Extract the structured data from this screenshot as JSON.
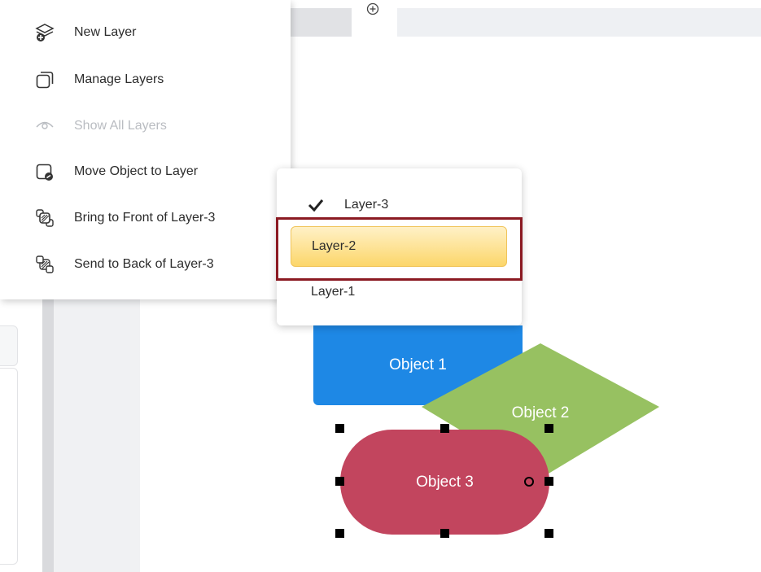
{
  "context_menu": {
    "items": [
      {
        "label": "New Layer",
        "icon": "new-layer-icon",
        "disabled": false
      },
      {
        "label": "Manage Layers",
        "icon": "manage-layers-icon",
        "disabled": false
      },
      {
        "label": "Show All Layers",
        "icon": "eye-icon",
        "disabled": true
      },
      {
        "label": "Move Object to Layer",
        "icon": "move-to-layer-icon",
        "disabled": false
      },
      {
        "label": "Bring to Front of Layer-3",
        "icon": "bring-front-icon",
        "disabled": false
      },
      {
        "label": "Send to Back of Layer-3",
        "icon": "send-back-icon",
        "disabled": false
      }
    ]
  },
  "layer_submenu": {
    "items": [
      {
        "label": "Layer-3",
        "checked": true
      },
      {
        "label": "Layer-2",
        "highlighted": true
      },
      {
        "label": "Layer-1"
      }
    ]
  },
  "diagram": {
    "object1": {
      "label": "Object 1",
      "color": "#1e88e5"
    },
    "object2": {
      "label": "Object 2",
      "color": "#97c161"
    },
    "object3": {
      "label": "Object 3",
      "color": "#c2455e"
    }
  },
  "colors": {
    "highlight_border": "#8b1a22",
    "selected_item_fill": "#fcd66a"
  }
}
